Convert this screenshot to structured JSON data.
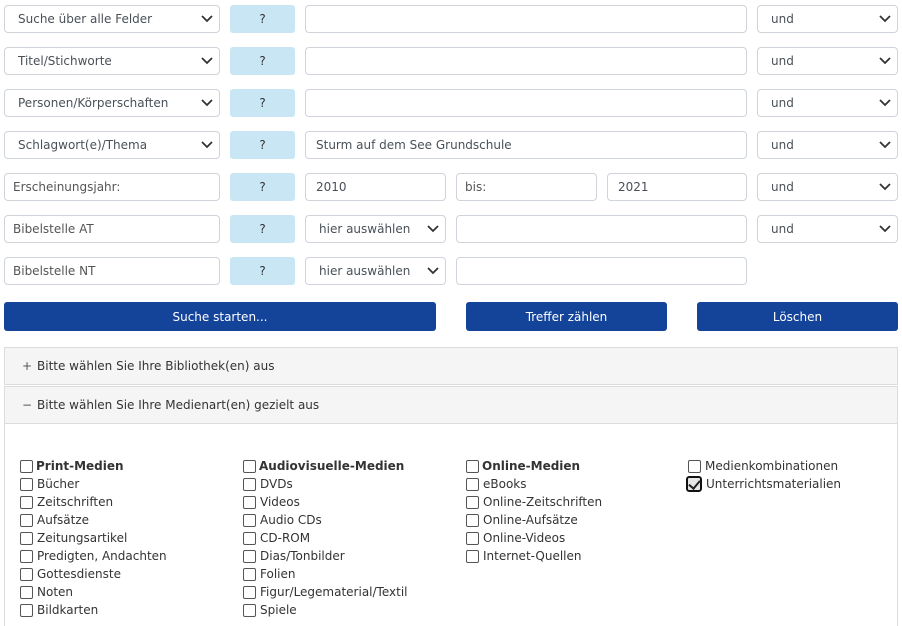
{
  "search_rows": [
    {
      "field": "Suche über alle Felder",
      "help": "?",
      "value": "",
      "operator": "und"
    },
    {
      "field": "Titel/Stichworte",
      "help": "?",
      "value": "",
      "operator": "und"
    },
    {
      "field": "Personen/Körperschaften",
      "help": "?",
      "value": "",
      "operator": "und"
    },
    {
      "field": "Schlagwort(e)/Thema",
      "help": "?",
      "value": "Sturm auf dem See Grundschule",
      "operator": "und"
    }
  ],
  "year_row": {
    "label": "Erscheinungsjahr:",
    "help": "?",
    "from": "2010",
    "to_label": "bis:",
    "to": "2021",
    "operator": "und"
  },
  "bible_at": {
    "label": "Bibelstelle AT",
    "help": "?",
    "select": "hier auswählen",
    "value": "",
    "operator": "und"
  },
  "bible_nt": {
    "label": "Bibelstelle NT",
    "help": "?",
    "select": "hier auswählen",
    "value": ""
  },
  "buttons": {
    "search": "Suche starten...",
    "count": "Treffer zählen",
    "clear": "Löschen"
  },
  "accordion": {
    "libraries": {
      "sign": "+",
      "label": "Bitte wählen Sie Ihre Bibliothek(en) aus"
    },
    "media": {
      "sign": "−",
      "label": "Bitte wählen Sie Ihre Medienart(en) gezielt aus"
    }
  },
  "media_columns": [
    {
      "heading": "Print-Medien",
      "items": [
        "Bücher",
        "Zeitschriften",
        "Aufsätze",
        "Zeitungsartikel",
        "Predigten, Andachten",
        "Gottesdienste",
        "Noten",
        "Bildkarten"
      ]
    },
    {
      "heading": "Audiovisuelle-Medien",
      "items": [
        "DVDs",
        "Videos",
        "Audio CDs",
        "CD-ROM",
        "Dias/Tonbilder",
        "Folien",
        "Figur/Legematerial/Textil",
        "Spiele"
      ]
    },
    {
      "heading": "Online-Medien",
      "items": [
        "eBooks",
        "Online-Zeitschriften",
        "Online-Aufsätze",
        "Online-Videos",
        "Internet-Quellen"
      ]
    },
    {
      "heading": "",
      "items": [
        "Medienkombinationen",
        "Unterrichtsmaterialien"
      ]
    }
  ],
  "checked": [
    "Unterrichtsmaterialien"
  ],
  "icons": {
    "dropdown": "chevron-down-icon",
    "checkbox": "checkbox-icon"
  },
  "colors": {
    "primary_button": "#14439a",
    "help_button": "#c9e6f5"
  }
}
